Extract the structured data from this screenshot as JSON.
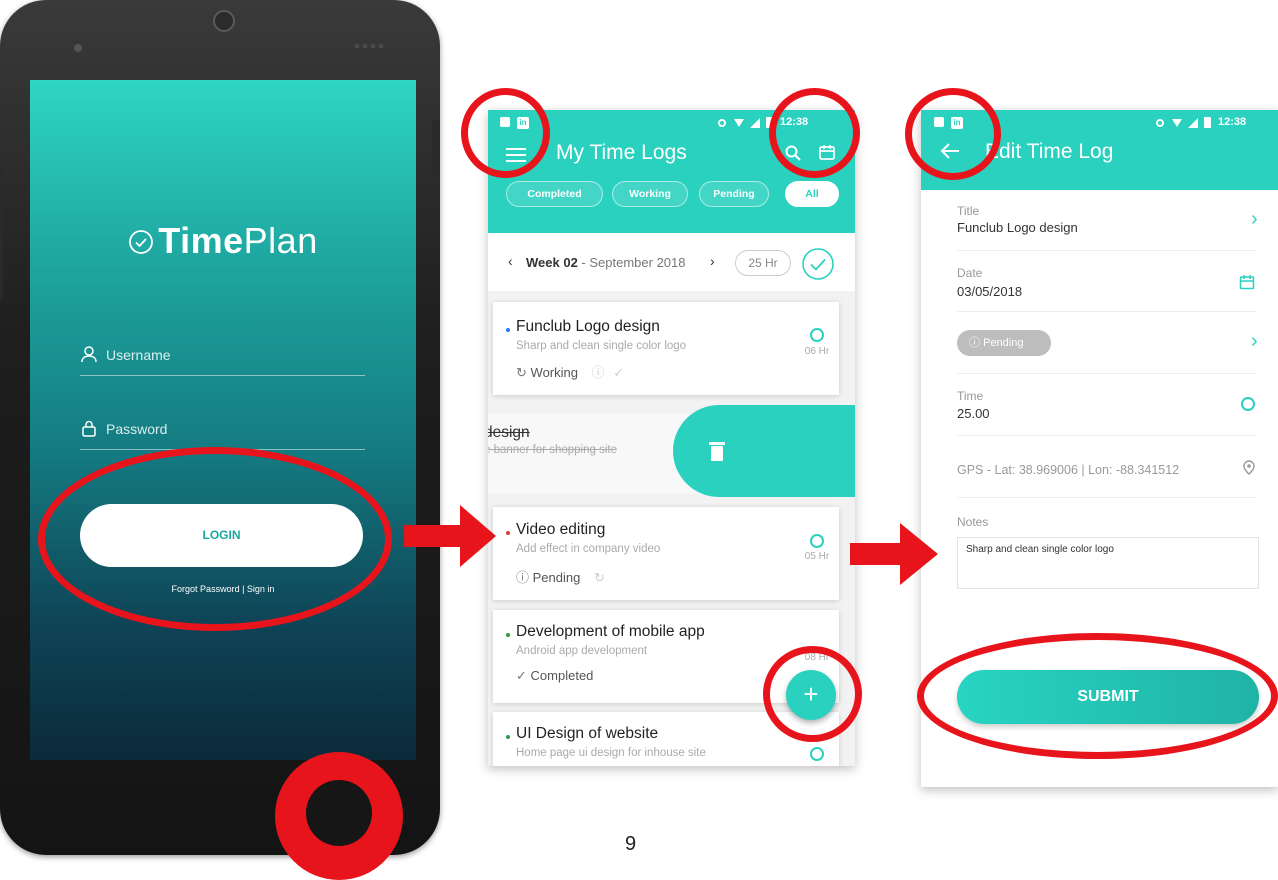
{
  "colors": {
    "accent": "#2ad1bf",
    "annotation": "#e8141b",
    "pending_dot": "#e53935",
    "working_dot": "#2979ff",
    "completed_dot": "#2e9e3e"
  },
  "login": {
    "logo_bold": "Time",
    "logo_light": "Plan",
    "username_placeholder": "Username",
    "password_placeholder": "Password",
    "login_label": "LOGIN",
    "forgot_text": "Forgot Password | Sign in"
  },
  "timelogs": {
    "title": "My Time Logs",
    "status_time": "12:38",
    "filters": [
      "Completed",
      "Working",
      "Pending",
      "All"
    ],
    "week_bold": "Week 02",
    "week_rest": "- September 2018",
    "total_hours": "25 Hr",
    "tasks": [
      {
        "title": "Funclub Logo design",
        "subtitle": "Sharp and clean single color logo",
        "status": "Working",
        "hours": "06 Hr"
      },
      {
        "title": "Video editing",
        "subtitle": "Add effect in company video",
        "status": "Pending",
        "hours": "05 Hr"
      },
      {
        "title": "Development of mobile app",
        "subtitle": "Android app development",
        "status": "Completed",
        "hours": "08 Hr"
      },
      {
        "title": "UI Design of website",
        "subtitle": "Home page ui design for inhouse site",
        "status": "",
        "hours": ""
      }
    ],
    "swiped_title": "design",
    "swiped_subtitle": "e banner for shopping site"
  },
  "edit": {
    "title": "Edit Time Log",
    "status_time": "12:38",
    "title_label": "Title",
    "title_value": "Funclub Logo design",
    "date_label": "Date",
    "date_value": "03/05/2018",
    "status_chip": "Pending",
    "time_label": "Time",
    "time_value": "25.00",
    "gps_text": "GPS -  Lat: 38.969006 | Lon: -88.341512",
    "notes_label": "Notes",
    "notes_value": "Sharp and clean single color logo",
    "submit_label": "SUBMIT"
  },
  "page_number": "9"
}
